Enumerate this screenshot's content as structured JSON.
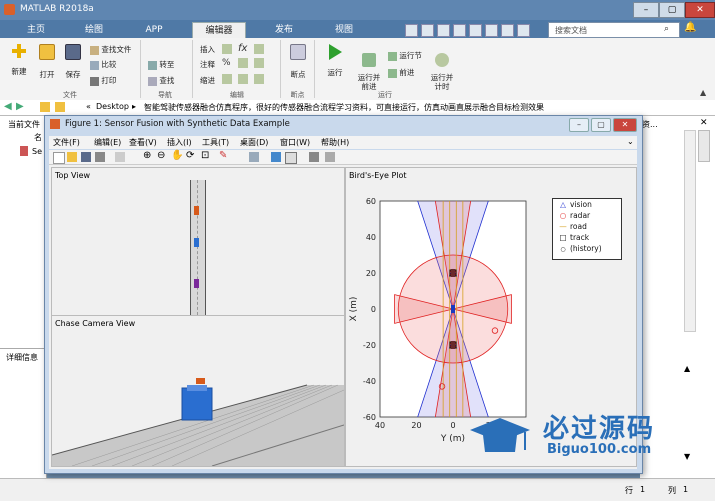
{
  "app": {
    "title": "MATLAB R2018a",
    "tabs": [
      "主页",
      "绘图",
      "APP",
      "编辑器",
      "发布",
      "视图"
    ],
    "active_tab": "编辑器",
    "search_placeholder": "搜索文档"
  },
  "ribbon": {
    "file_group": {
      "new": "新建",
      "open": "打开",
      "save": "保存",
      "find_files": "查找文件",
      "compare": "比较",
      "print": "打印",
      "label": "文件"
    },
    "nav_group": {
      "goto": "转至",
      "find": "查找",
      "label": "导航"
    },
    "edit_group": {
      "insert": "插入",
      "comment": "注释",
      "indent": "缩进",
      "fx": "fx",
      "label": "编辑"
    },
    "breakpoint_group": {
      "breakpoints": "断点",
      "label": "断点"
    },
    "run_group": {
      "run": "运行",
      "run_advance": "运行并\n前进",
      "run_section": "运行节",
      "advance": "前进",
      "run_time": "运行并\n计时",
      "label": "运行"
    }
  },
  "address_bar": {
    "path_root": "Desktop",
    "path_folder": "智能驾驶传感器融合仿真程序，很好的传感器融合流程学习资料，可直接运行，仿真动画直展示融合目标检测效果"
  },
  "left_panel": {
    "header": "当前文件",
    "col_name": "名",
    "file1": "Se",
    "details": "详细信息"
  },
  "right_panel": {
    "header_suffix": "资..."
  },
  "figure": {
    "title": "Figure 1: Sensor Fusion with Synthetic Data Example",
    "menus": [
      "文件(F)",
      "编辑(E)",
      "查看(V)",
      "插入(I)",
      "工具(T)",
      "桌面(D)",
      "窗口(W)",
      "帮助(H)"
    ],
    "panels": {
      "top_view": "Top View",
      "chase_view": "Chase Camera View",
      "birds_eye": "Bird's-Eye Plot"
    }
  },
  "chart_data": {
    "type": "scatter",
    "title": "Bird's-Eye Plot",
    "xlabel": "Y (m)",
    "ylabel": "X (m)",
    "xlim": [
      40,
      -40
    ],
    "ylim": [
      -60,
      60
    ],
    "xticks": [
      40,
      20,
      0,
      -20
    ],
    "yticks": [
      60,
      40,
      20,
      0,
      -20,
      -40,
      -60
    ],
    "legend": [
      "vision",
      "radar",
      "road",
      "track",
      "(history)"
    ],
    "legend_placement": "top-right",
    "colors": {
      "vision": "#2030d0",
      "radar": "#e02020",
      "road": "#d4a020",
      "track": "#000000"
    },
    "series": [
      {
        "name": "vision",
        "values": [
          [
            0,
            20
          ],
          [
            0,
            -20
          ]
        ]
      },
      {
        "name": "radar",
        "values": [
          [
            -23,
            -12
          ],
          [
            6,
            -43
          ],
          [
            0,
            20
          ],
          [
            0,
            -20
          ]
        ]
      },
      {
        "name": "track",
        "values": [
          [
            0,
            20
          ],
          [
            0,
            -20
          ]
        ]
      }
    ]
  },
  "status_bar": {
    "line_label": "行",
    "line_value": "1",
    "col_label": "列",
    "col_value": "1"
  },
  "watermark": {
    "text1": "必过源码",
    "text2": "Biguo100.com"
  }
}
